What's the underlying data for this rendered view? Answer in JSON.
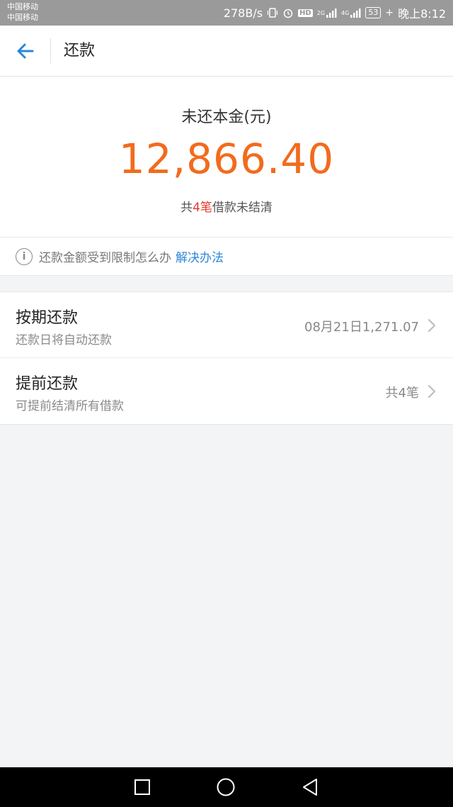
{
  "status_bar": {
    "carrier_1": "中国移动",
    "carrier_2": "中国移动",
    "speed": "278B/s",
    "hd": "HD",
    "network_2g": "2G",
    "network_4g": "4G",
    "battery": "53",
    "time": "晚上8:12"
  },
  "header": {
    "title": "还款"
  },
  "summary": {
    "label": "未还本金(元)",
    "amount": "12,866.40",
    "sub_prefix": "共",
    "sub_count": "4笔",
    "sub_suffix": "借款未结清"
  },
  "notice": {
    "text": "还款金额受到限制怎么办",
    "link": "解决办法"
  },
  "list": {
    "items": [
      {
        "title": "按期还款",
        "subtitle": "还款日将自动还款",
        "value": "08月21日1,271.07"
      },
      {
        "title": "提前还款",
        "subtitle": "可提前结清所有借款",
        "value": "共4笔"
      }
    ]
  },
  "colors": {
    "accent_orange": "#f26b1d",
    "count_red": "#e8372c",
    "link_blue": "#2c86d8",
    "back_arrow_blue": "#2c86d8"
  }
}
